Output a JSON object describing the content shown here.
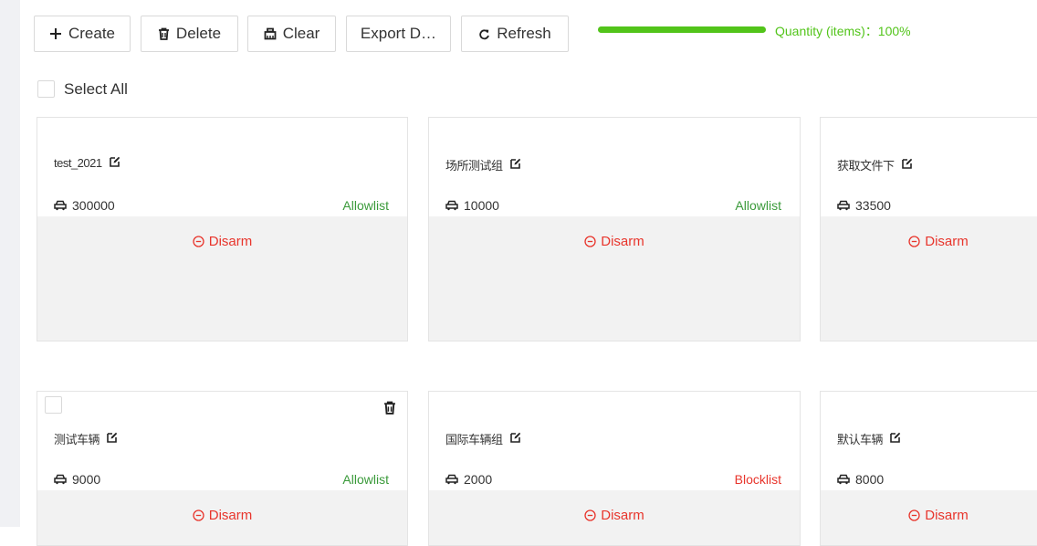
{
  "toolbar": {
    "create_label": "Create",
    "delete_label": "Delete",
    "clear_label": "Clear",
    "export_label": "Export D…",
    "refresh_label": "Refresh"
  },
  "quantity": {
    "label": "Quantity (items)：100%",
    "progress_fraction": 1.0,
    "color": "#52c41a"
  },
  "select_all_label": "Select All",
  "icons": {
    "create": "plus-icon",
    "delete": "trash-icon",
    "clear": "clear-icon",
    "refresh": "refresh-icon",
    "edit": "edit-icon",
    "quantity": "car-icon",
    "disarm": "minus-circle-icon"
  },
  "colors": {
    "allowlist": "#3a9a3a",
    "blocklist": "#e8352c",
    "disarm": "#e8352c"
  },
  "cards": [
    {
      "name": "test_2021",
      "quantity": "300000",
      "list": "Allowlist",
      "action": "Disarm"
    },
    {
      "name": "场所测试组",
      "quantity": "10000",
      "list": "Allowlist",
      "action": "Disarm"
    },
    {
      "name": "获取文件下",
      "quantity": "33500",
      "list": "",
      "action": "Disarm"
    },
    {
      "name": "测试车辆",
      "quantity": "9000",
      "list": "Allowlist",
      "action": "Disarm"
    },
    {
      "name": "国际车辆组",
      "quantity": "2000",
      "list": "Blocklist",
      "action": "Disarm"
    },
    {
      "name": "默认车辆",
      "quantity": "8000",
      "list": "",
      "action": "Disarm"
    }
  ]
}
